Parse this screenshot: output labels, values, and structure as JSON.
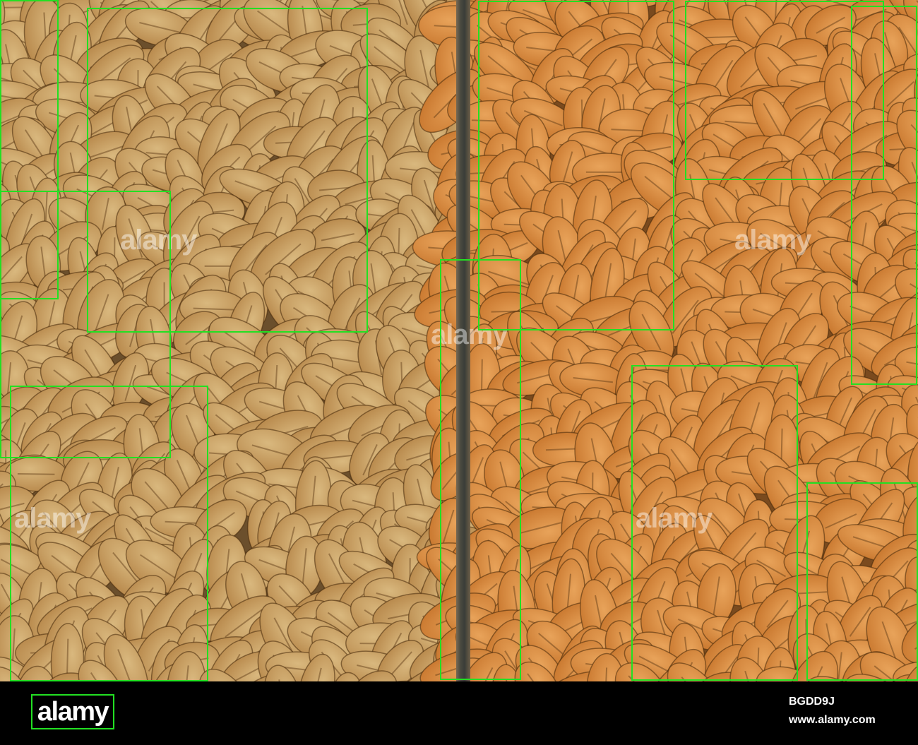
{
  "photo": {
    "description_icon": "wheat-grains-photo",
    "colors": {
      "left_grain_light": "#d9b87e",
      "left_grain_dark": "#b8894c",
      "right_grain_light": "#e8a35a",
      "right_grain_dark": "#c9782f",
      "divider": "#3a3d38",
      "box_outline": "#22e022"
    },
    "watermark_text": "alamy"
  },
  "footer": {
    "logo_text": "alamy",
    "image_id": "BGDD9J",
    "site": "www.alamy.com"
  }
}
